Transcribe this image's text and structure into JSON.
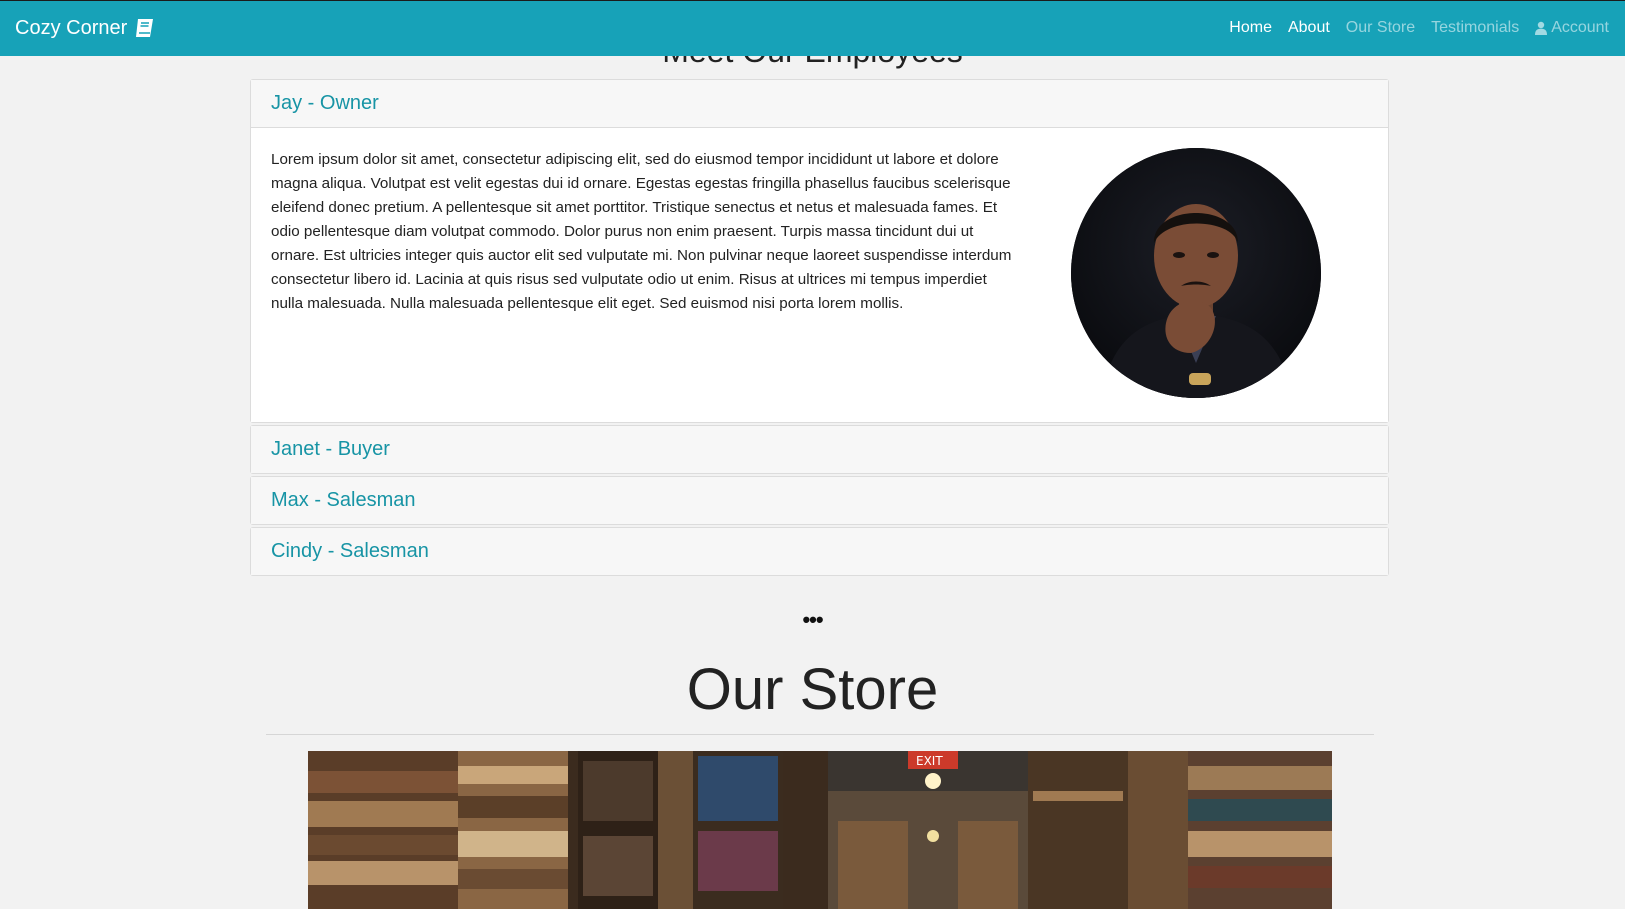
{
  "navbar": {
    "brand": "Cozy Corner",
    "brand_icon": "book-icon",
    "accent_color": "#17a2b8",
    "links": [
      {
        "label": "Home",
        "active": true
      },
      {
        "label": "About",
        "active": true
      },
      {
        "label": "Our Store",
        "active": false
      },
      {
        "label": "Testimonials",
        "active": false
      },
      {
        "label": "Account",
        "active": false,
        "icon": "user-icon"
      }
    ]
  },
  "employees": {
    "heading": "Meet Our Employees",
    "items": [
      {
        "title": "Jay - Owner",
        "expanded": true,
        "bio": "Lorem ipsum dolor sit amet, consectetur adipiscing elit, sed do eiusmod tempor incididunt ut labore et dolore magna aliqua. Volutpat est velit egestas dui id ornare. Egestas egestas fringilla phasellus faucibus scelerisque eleifend donec pretium. A pellentesque sit amet porttitor. Tristique senectus et netus et malesuada fames. Et odio pellentesque diam volutpat commodo. Dolor purus non enim praesent. Turpis massa tincidunt dui ut ornare. Est ultricies integer quis auctor elit sed vulputate mi. Non pulvinar neque laoreet suspendisse interdum consectetur libero id. Lacinia at quis risus sed vulputate odio ut enim. Risus at ultrices mi tempus imperdiet nulla malesuada. Nulla malesuada pellentesque elit eget. Sed euismod nisi porta lorem mollis."
      },
      {
        "title": "Janet - Buyer",
        "expanded": false
      },
      {
        "title": "Max - Salesman",
        "expanded": false
      },
      {
        "title": "Cindy - Salesman",
        "expanded": false
      }
    ]
  },
  "divider": "•••",
  "store": {
    "title": "Our Store",
    "exit_sign": "EXIT"
  }
}
